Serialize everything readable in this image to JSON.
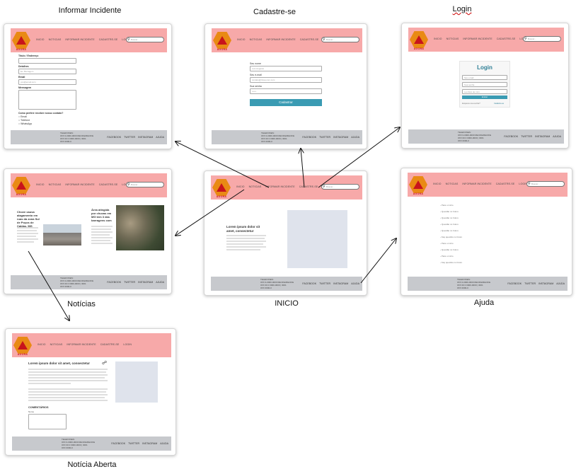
{
  "captions": {
    "informar": "Informar Incidente",
    "cadastre": "Cadastre-se",
    "login": "Login",
    "noticias": "Notícias",
    "inicio": "INICIO",
    "ajuda": "Ajuda",
    "noticia_aberta": "Notícia Aberta"
  },
  "colors": {
    "header": "#f7a9a9",
    "footer": "#c7c9cd",
    "accent": "#3a9bb3",
    "logo_hex": "#e98a14",
    "logo_tri": "#c8141c"
  },
  "site": {
    "brand": "AGORA",
    "nav": [
      "INICIO",
      "NOTICIAS",
      "INFORMAR INCIDENTE",
      "CADASTRE-SE",
      "LOGIN"
    ],
    "search_placeholder": "Buscar...",
    "footer_address": [
      "TELEFONES:",
      "0XX 0-0000-0000 RECIFE/RECIFE",
      "0XX 00 0 0000-0000 | 3001",
      "0XX 0000-0"
    ],
    "footer_social": [
      "FACEBOOK",
      "TWITTER",
      "INSTAGRAM",
      "AJUDA"
    ]
  },
  "informar": {
    "f1": "Título / Endereço",
    "f2": "Detalhes",
    "f2_ph": "Ex: Barragem",
    "f3": "Email",
    "f3_ph": "you@email.com",
    "f4": "Mensagem",
    "q": "Como prefere receber nosso contato?",
    "opts": [
      "Email",
      "Telefone",
      "WhatsApp"
    ]
  },
  "cadastre": {
    "name_label": "Seu nome",
    "name_val": "Luis Augusto",
    "email_label": "Seu e-mail",
    "email_val": "contato@Intsa.com.com",
    "pass_label": "Sua senha",
    "pass_val": "••••••",
    "button": "Cadastrar"
  },
  "login": {
    "title": "Login",
    "user_ph": "Seu email",
    "pass_ph": "Sua senha",
    "remember": "Lembrar de mim",
    "button": "Entrar",
    "forgot": "Esqueceu sua senha?",
    "signup": "Cadastre-se"
  },
  "noticias": {
    "a1_title": "Chove causa alagamento em ruas da zona Sul de Poços de Caldas, MG",
    "a2_title": "Área atingida por chuvas em MG tem 3 das barragens com"
  },
  "inicio": {
    "heading": "Lorem ipsum dolor sit amet, consectetur"
  },
  "ajuda": {
    "items": [
      "Para o início",
      "Questão no futuro",
      "Questão no futuro",
      "Questão no futuro",
      "Questão no futuro",
      "Faq questão no futuro",
      "Para o início",
      "Questão no futuro",
      "Para o início",
      "Faq questão no futuro"
    ]
  },
  "aberta": {
    "title": "Lorem ipsum dolor sit amet, consectetur",
    "comments": "COMENTÁRIOS",
    "comment_label": "Nome"
  }
}
